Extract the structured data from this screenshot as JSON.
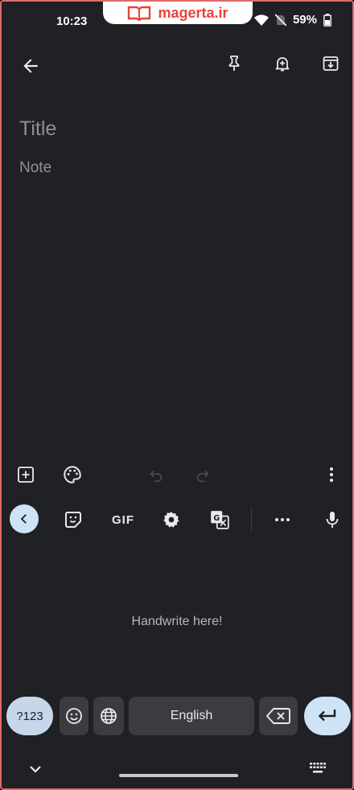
{
  "status_bar": {
    "time": "10:23",
    "watermark_text": "magerta.ir",
    "battery": "59%"
  },
  "toolbar": {
    "back_icon": "arrow-left-icon",
    "pin_icon": "pin-icon",
    "reminder_icon": "bell-plus-icon",
    "archive_icon": "archive-icon"
  },
  "note": {
    "title_placeholder": "Title",
    "body_placeholder": "Note"
  },
  "note_toolbar": {
    "add_icon": "add-box-icon",
    "palette_icon": "palette-icon",
    "undo_icon": "undo-icon",
    "redo_icon": "redo-icon",
    "more_icon": "more-vert-icon"
  },
  "keyboard": {
    "toolbar": {
      "gif_label": "GIF",
      "collapse_icon": "chevron-left-icon",
      "sticker_icon": "sticker-icon",
      "settings_icon": "gear-icon",
      "translate_icon": "translate-icon",
      "more_icon": "more-horiz-icon",
      "mic_icon": "microphone-icon"
    },
    "handwrite_hint": "Handwrite here!",
    "keys": {
      "symbols_label": "?123",
      "space_label": "English",
      "emoji_icon": "emoji-icon",
      "globe_icon": "globe-icon",
      "backspace_icon": "backspace-icon",
      "enter_icon": "enter-icon"
    }
  },
  "colors": {
    "background": "#202124",
    "accent": "#cfe3f7",
    "watermark": "#e8423b"
  }
}
